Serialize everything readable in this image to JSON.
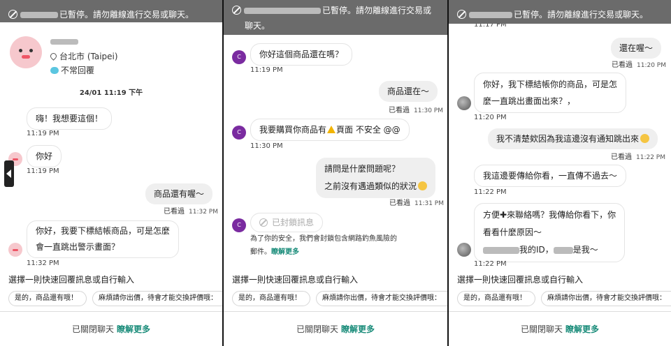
{
  "panel1": {
    "banner": "已暫停。請勿離線進行交易或聊天。",
    "profile_location": "台北市 (Taipei)",
    "profile_status": "不常回覆",
    "date_divider": "24/01 11:19 下午",
    "msgs": [
      {
        "text": "嗨！我想要這個！",
        "time": "11:19 PM"
      },
      {
        "text": "你好",
        "time": "11:19 PM"
      },
      {
        "text": "商品還有喔～",
        "seen": "已看過",
        "time": "11:32 PM"
      },
      {
        "line1": "你好，我要下標結帳商品，可是怎麼",
        "line2": "會一直跳出警示畫面？",
        "time": "11:32 PM"
      }
    ],
    "quick_title": "選擇一則快速回覆訊息或自行輸入",
    "chips": [
      "是的，商品還有哦！",
      "麻煩請你出價，待會才能交換評價哦："
    ],
    "footer_text": "已關閉聊天",
    "footer_link": "瞭解更多"
  },
  "panel2": {
    "banner_l1": "已暫停。請勿離線進行交易或",
    "banner_l2": "聊天。",
    "avatar_letter": "C",
    "msgs": [
      {
        "text": "你好這個商品還在嗎？",
        "time": "11:19 PM"
      },
      {
        "text": "商品還在～",
        "seen": "已看過",
        "time": "11:30 PM"
      },
      {
        "pre": "我要購買你商品有",
        "post": "頁面 不安全 @@",
        "time": "11:30 PM"
      },
      {
        "line1": "請問是什麼問題呢？",
        "line2": "之前沒有遇過類似的狀況",
        "seen": "已看過",
        "time": "11:31 PM"
      }
    ],
    "locked_label": "已封鎖訊息",
    "lock_line1": "為了你的安全，我們會封鎖包含網路釣魚風險的",
    "lock_line2": "郵件。",
    "lock_link": "瞭解更多",
    "quick_title": "選擇一則快速回覆訊息或自行輸入",
    "chips": [
      "是的，商品還有哦！",
      "麻煩請你出價，待會才能交換評價哦："
    ],
    "footer_text": "已關閉聊天",
    "footer_link": "瞭解更多"
  },
  "panel3": {
    "banner": "已暫停。請勿離線進行交易或聊天。",
    "top_time": "11:17 PM",
    "msgs": [
      {
        "text": "還在喔～",
        "seen": "已看過",
        "time": "11:20 PM"
      },
      {
        "line1": "你好，我下標結帳你的商品，可是怎",
        "line2": "麼一直跳出畫面出來？，",
        "time": "11:20 PM"
      },
      {
        "text": "我不清楚欸因為我這邊沒有通知跳出來",
        "seen": "已看過",
        "time": "11:22 PM"
      },
      {
        "text": "我這邊要傳給你看，一直傳不過去～",
        "time": "11:22 PM"
      },
      {
        "line1a": "方便",
        "line1b": "來聯絡嗎？我傳給你看下，你",
        "line2": "看看什麼原因～",
        "line3a": "我的ID，",
        "line3b": "是我～",
        "time": "11:22 PM"
      }
    ],
    "quick_title": "選擇一則快速回覆訊息或自行輸入",
    "chips": [
      "是的，商品還有哦！",
      "麻煩請你出價，待會才能交換評價哦："
    ],
    "footer_text": "已關閉聊天",
    "footer_link": "瞭解更多"
  },
  "colors": {
    "banner": "#6b6b6b",
    "link": "#1a8c7a",
    "avatar_c": "#7a2ba0"
  }
}
